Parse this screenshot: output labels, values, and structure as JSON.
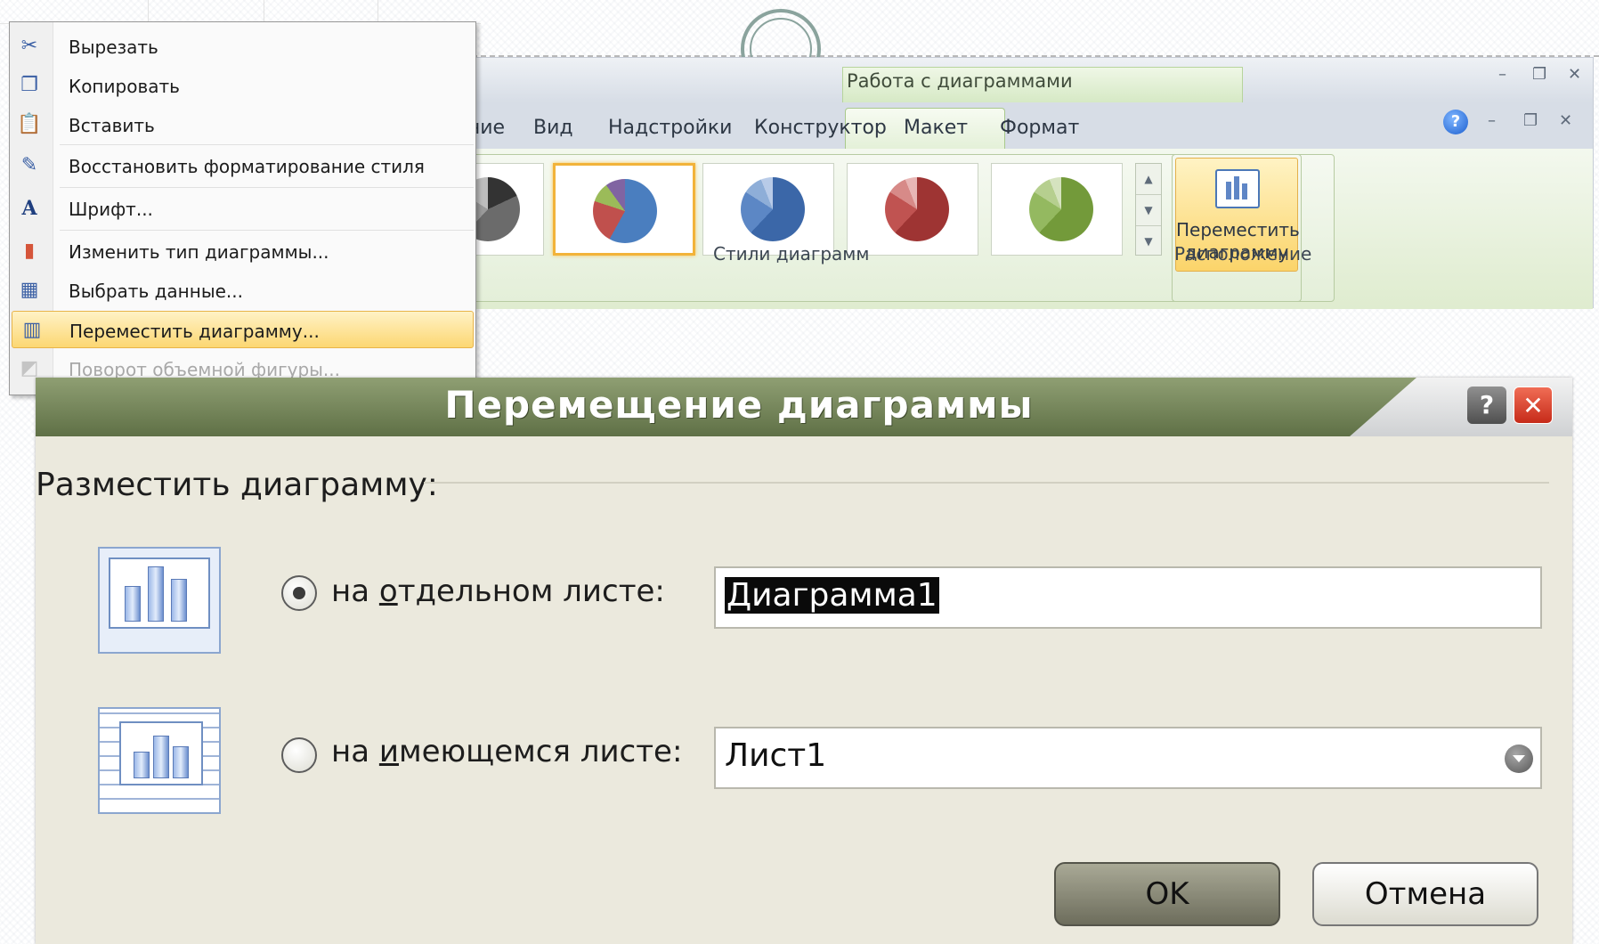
{
  "menu": {
    "items": [
      {
        "label": "Вырезать",
        "icon": "scissors-icon"
      },
      {
        "label": "Копировать",
        "icon": "copy-icon"
      },
      {
        "label": "Вставить",
        "icon": "paste-icon"
      },
      {
        "label": "Восстановить форматирование стиля",
        "icon": "reset-style-icon"
      },
      {
        "label": "Шрифт...",
        "icon": "font-icon"
      },
      {
        "label": "Изменить тип диаграммы...",
        "icon": "chart-type-icon"
      },
      {
        "label": "Выбрать данные...",
        "icon": "select-data-icon"
      },
      {
        "label": "Переместить диаграмму...",
        "icon": "move-chart-icon"
      },
      {
        "label": "Поворот объемной фигуры...",
        "icon": "rotate-3d-icon"
      }
    ]
  },
  "ribbon": {
    "context_group": "Работа с диаграммами",
    "tabs": [
      "рование",
      "Вид",
      "Надстройки",
      "Конструктор",
      "Макет",
      "Формат"
    ],
    "active_tab": "Конструктор",
    "styles_group_label": "Стили диаграмм",
    "move_button_line1": "Переместить",
    "move_button_line2": "диаграмму",
    "location_group_label": "Расположение",
    "pie_colors": [
      "#555555",
      "#4a7ebf",
      "#3b67a8",
      "#a83a3a",
      "#7aa43c"
    ]
  },
  "dialog": {
    "title": "Перемещение диаграммы",
    "help_button": "?",
    "close_button": "✕",
    "section_label": "Разместить диаграмму:",
    "option1_pre": "на ",
    "option1_ul": "о",
    "option1_post": "тдельном листе:",
    "option1_value": "Диаграмма1",
    "option2_pre": "на ",
    "option2_ul": "и",
    "option2_post": "меющемся листе:",
    "option2_value": "Лист1",
    "ok_label": "OK",
    "cancel_label": "Отмена"
  }
}
